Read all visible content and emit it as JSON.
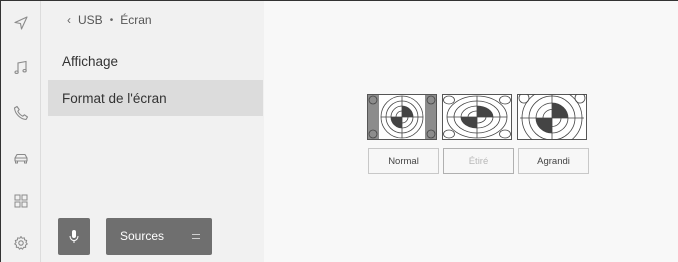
{
  "rail": {
    "icons": [
      "navigation-icon",
      "music-icon",
      "phone-icon",
      "car-icon",
      "apps-icon",
      "settings-icon"
    ]
  },
  "breadcrumb": {
    "source": "USB",
    "page": "Écran"
  },
  "menu": {
    "items": [
      {
        "label": "Affichage",
        "active": false
      },
      {
        "label": "Format de l'écran",
        "active": true
      }
    ]
  },
  "bottom": {
    "sources_label": "Sources"
  },
  "screen_format": {
    "options": [
      {
        "label": "Normal",
        "selected": false
      },
      {
        "label": "Étiré",
        "selected": true
      },
      {
        "label": "Agrandi",
        "selected": false
      }
    ]
  },
  "colors": {
    "panel_bg": "#f1f1f1",
    "main_bg": "#f8f8f8",
    "active_item": "#dcdcdc",
    "button_dark": "#6f6f6f"
  }
}
